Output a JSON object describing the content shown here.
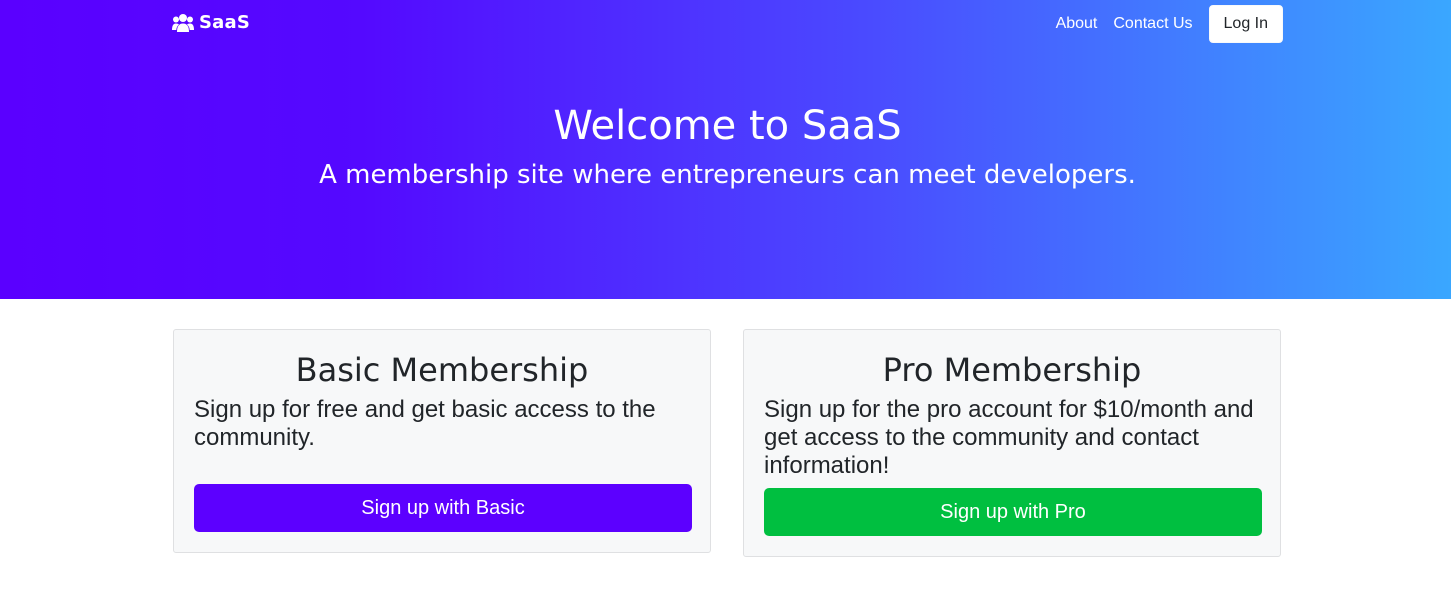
{
  "navbar": {
    "brand_icon": "users-icon",
    "brand_label": "SaaS",
    "links": [
      "About",
      "Contact Us"
    ],
    "login_label": "Log In"
  },
  "hero": {
    "title": "Welcome to SaaS",
    "subtitle": "A membership site where entrepreneurs can meet developers."
  },
  "cards": [
    {
      "title": "Basic Membership",
      "text": "Sign up for free and get basic access to the community.",
      "button_label": "Sign up with Basic",
      "button_color": "#5c00ff"
    },
    {
      "title": "Pro Membership",
      "text": "Sign up for the pro account for $10/month and get access to the community and contact information!",
      "button_label": "Sign up with Pro",
      "button_color": "#00bf40"
    }
  ],
  "colors": {
    "hero_gradient_start": "#5a00ff",
    "hero_gradient_end": "#3aa7ff",
    "card_background": "#f7f8f9"
  }
}
